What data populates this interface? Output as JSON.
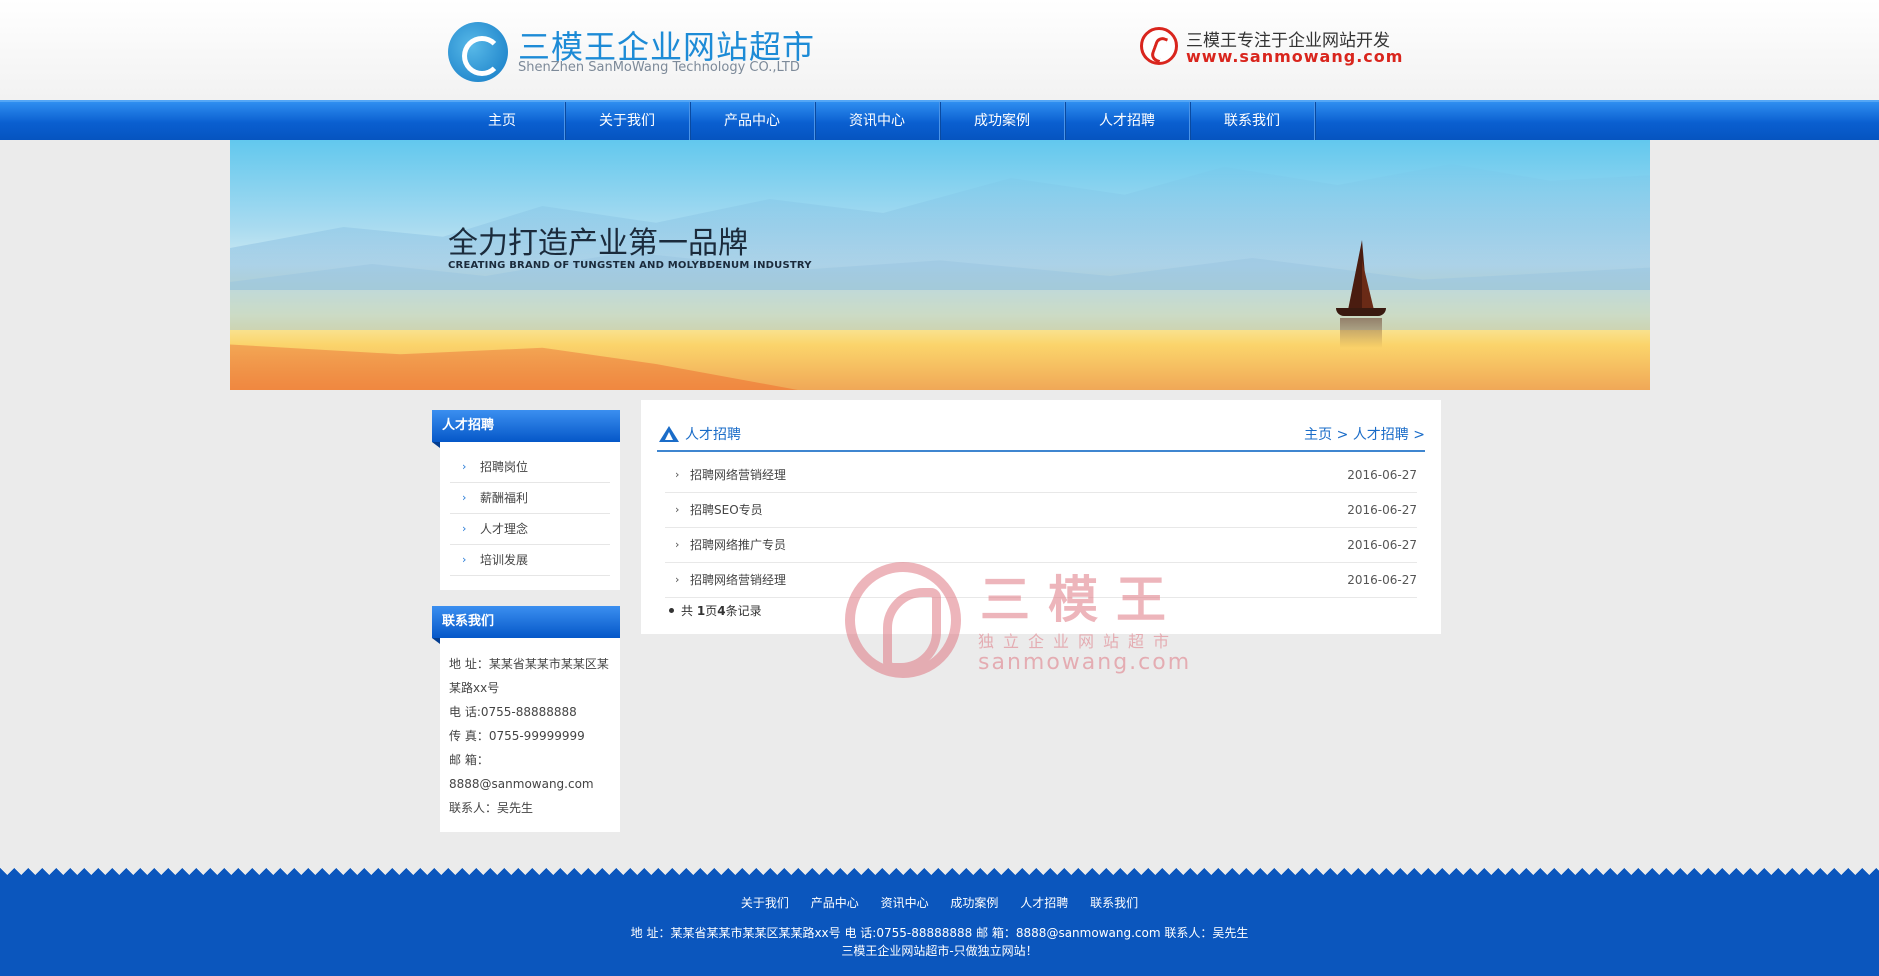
{
  "header": {
    "logo_title": "三模王企业网站超市",
    "logo_subtitle": "ShenZhen SanMoWang Technology CO.,LTD",
    "hotline_title": "三模王专注于企业网站开发",
    "hotline_url": "www.sanmowang.com"
  },
  "nav": {
    "items": [
      "主页",
      "关于我们",
      "产品中心",
      "资讯中心",
      "成功案例",
      "人才招聘",
      "联系我们"
    ]
  },
  "banner": {
    "title": "全力打造产业第一品牌",
    "subtitle": "CREATING BRAND OF TUNGSTEN AND MOLYBDENUM INDUSTRY"
  },
  "sidebar": {
    "jobs_title": "人才招聘",
    "jobs_items": [
      "招聘岗位",
      "薪酬福利",
      "人才理念",
      "培训发展"
    ],
    "contact_title": "联系我们",
    "contact_address": "地 址：某某省某某市某某区某某路xx号",
    "contact_phone": "电 话:0755-88888888",
    "contact_fax": "传 真：0755-99999999",
    "contact_email_label": "邮 箱：",
    "contact_email": "8888@sanmowang.com",
    "contact_person": "联系人：吴先生"
  },
  "main": {
    "title": "人才招聘",
    "breadcrumb_home": "主页 >",
    "breadcrumb_current": "人才招聘 >",
    "jobs": [
      {
        "title": "招聘网络营销经理",
        "date": "2016-06-27"
      },
      {
        "title": "招聘SEO专员",
        "date": "2016-06-27"
      },
      {
        "title": "招聘网络推广专员",
        "date": "2016-06-27"
      },
      {
        "title": "招聘网络营销经理",
        "date": "2016-06-27"
      }
    ],
    "pager_prefix": "共 ",
    "pager_pages": "1",
    "pager_mid": "页",
    "pager_count": "4",
    "pager_suffix": "条记录"
  },
  "watermark": {
    "big": "三模王",
    "mid": "独立企业网站超市",
    "url": "sanmowang.com"
  },
  "footer": {
    "links": [
      "关于我们",
      "产品中心",
      "资讯中心",
      "成功案例",
      "人才招聘",
      "联系我们"
    ],
    "address": "地 址：某某省某某市某某区某某路xx号 电 话:0755-88888888 邮 箱：8888@sanmowang.com 联系人：吴先生",
    "copyright": "三模王企业网站超市-只做独立网站！"
  },
  "colors": {
    "nav_blue": "#0a5fd0",
    "link_blue": "#1a6cc8",
    "hotline_red": "#d9251d",
    "watermark_red": "#e07a84"
  }
}
